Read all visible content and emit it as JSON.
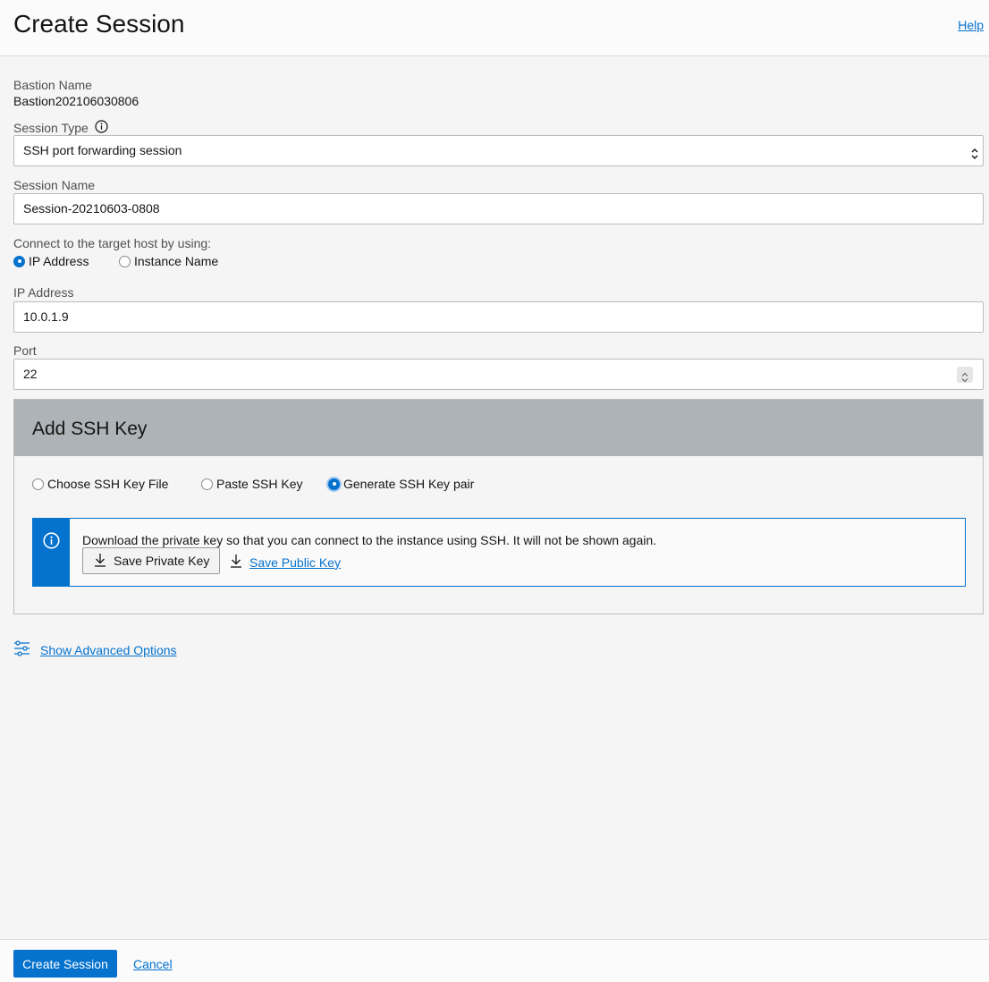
{
  "header": {
    "title": "Create Session",
    "help": "Help"
  },
  "form": {
    "bastion_name_label": "Bastion Name",
    "bastion_name_value": "Bastion202106030806",
    "session_type_label": "Session Type",
    "session_type_value": "SSH port forwarding session",
    "session_name_label": "Session Name",
    "session_name_value": "Session-20210603-0808",
    "connect_label": "Connect to the target host by using:",
    "connect_options": [
      {
        "label": "IP Address",
        "selected": true
      },
      {
        "label": "Instance Name",
        "selected": false
      }
    ],
    "ip_label": "IP Address",
    "ip_value": "10.0.1.9",
    "port_label": "Port",
    "port_value": "22"
  },
  "ssh_key": {
    "title": "Add SSH Key",
    "options": [
      {
        "label": "Choose SSH Key File",
        "selected": false
      },
      {
        "label": "Paste SSH Key",
        "selected": false
      },
      {
        "label": "Generate SSH Key pair",
        "selected": true
      }
    ],
    "info_text": "Download the private key so that you can connect to the instance using SSH. It will not be shown again.",
    "save_private": "Save Private Key",
    "save_public": "Save Public Key"
  },
  "advanced": {
    "label": "Show Advanced Options"
  },
  "footer": {
    "primary": "Create Session",
    "cancel": "Cancel"
  },
  "colors": {
    "accent": "#0572ce",
    "panel_header": "#aeb3b8"
  }
}
